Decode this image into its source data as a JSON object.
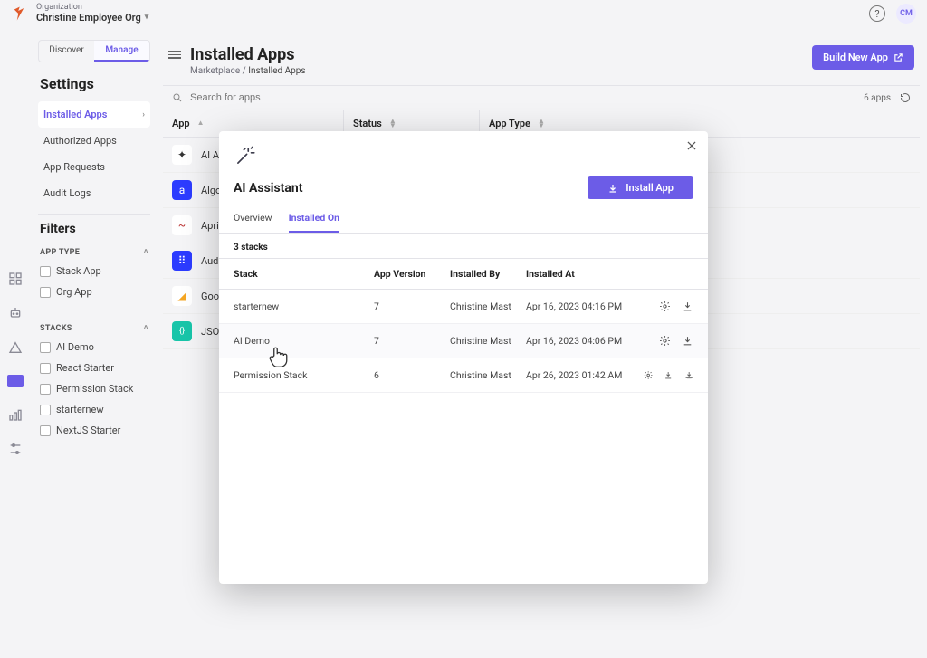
{
  "top": {
    "org_label": "Organization",
    "org_name": "Christine Employee Org",
    "avatar": "CM"
  },
  "sidebar": {
    "segment": {
      "discover": "Discover",
      "manage": "Manage"
    },
    "settings_heading": "Settings",
    "items": [
      {
        "label": "Installed Apps",
        "active": true
      },
      {
        "label": "Authorized Apps"
      },
      {
        "label": "App Requests"
      },
      {
        "label": "Audit Logs"
      }
    ],
    "filters_heading": "Filters",
    "app_type_heading": "APP TYPE",
    "app_type_options": [
      {
        "label": "Stack App"
      },
      {
        "label": "Org App"
      }
    ],
    "stacks_heading": "STACKS",
    "stacks_options": [
      {
        "label": "AI Demo"
      },
      {
        "label": "React Starter"
      },
      {
        "label": "Permission Stack"
      },
      {
        "label": "starternew"
      },
      {
        "label": "NextJS Starter"
      }
    ]
  },
  "main": {
    "title": "Installed Apps",
    "crumb_root": "Marketplace",
    "crumb_sep": " / ",
    "crumb_current": "Installed Apps",
    "build_button": "Build New App",
    "search_placeholder": "Search for apps",
    "apps_count": "6 apps",
    "columns": {
      "app": "App",
      "status": "Status",
      "type": "App Type"
    },
    "apps": [
      {
        "name": "AI Assistant",
        "icon_bg": "#ffffff",
        "icon_char": "✨"
      },
      {
        "name": "Algolia",
        "icon_bg": "#2c3cff",
        "icon_char": "a"
      },
      {
        "name": "Aprimo",
        "icon_bg": "#ffffff",
        "icon_char": "~"
      },
      {
        "name": "Audience",
        "icon_bg": "#2c3cff",
        "icon_char": "⠿"
      },
      {
        "name": "Google Analytics",
        "icon_bg": "#ffffff",
        "icon_char": "📊"
      },
      {
        "name": "JSON Editor",
        "icon_bg": "#18c5a9",
        "icon_char": "{}"
      }
    ]
  },
  "modal": {
    "title": "AI Assistant",
    "install_label": "Install App",
    "tabs": {
      "overview": "Overview",
      "installed_on": "Installed On"
    },
    "stacks_summary": "3 stacks",
    "columns": {
      "stack": "Stack",
      "version": "App Version",
      "by": "Installed By",
      "at": "Installed At"
    },
    "rows": [
      {
        "stack": "starternew",
        "version": "7",
        "by": "Christine Mast...",
        "at": "Apr 16, 2023 04:16 PM",
        "extra_action": false
      },
      {
        "stack": "AI Demo",
        "version": "7",
        "by": "Christine Mast...",
        "at": "Apr 16, 2023 04:06 PM",
        "extra_action": false
      },
      {
        "stack": "Permission Stack",
        "version": "6",
        "by": "Christine Mast...",
        "at": "Apr 26, 2023 01:42 AM",
        "extra_action": true
      }
    ]
  }
}
